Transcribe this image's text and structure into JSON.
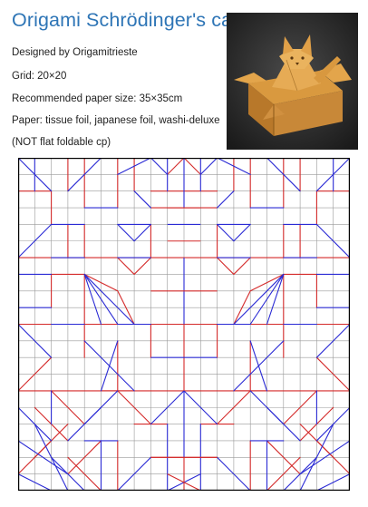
{
  "doc": {
    "title": "Origami Schrödinger's cat",
    "lines": [
      "Designed by Origamitrieste",
      "Grid: 20×20",
      "Recommended paper size: 35×35cm",
      "Paper: tissue foil, japanese foil, washi-deluxe",
      "(NOT flat foldable cp)"
    ]
  },
  "photo": {
    "subject": "folded-origami-cat-in-box"
  },
  "crease_pattern": {
    "grid": 20,
    "colors": {
      "mountain": "#d42a2a",
      "valley": "#2a2ad4",
      "grid": "#999999",
      "border": "#000000"
    }
  }
}
